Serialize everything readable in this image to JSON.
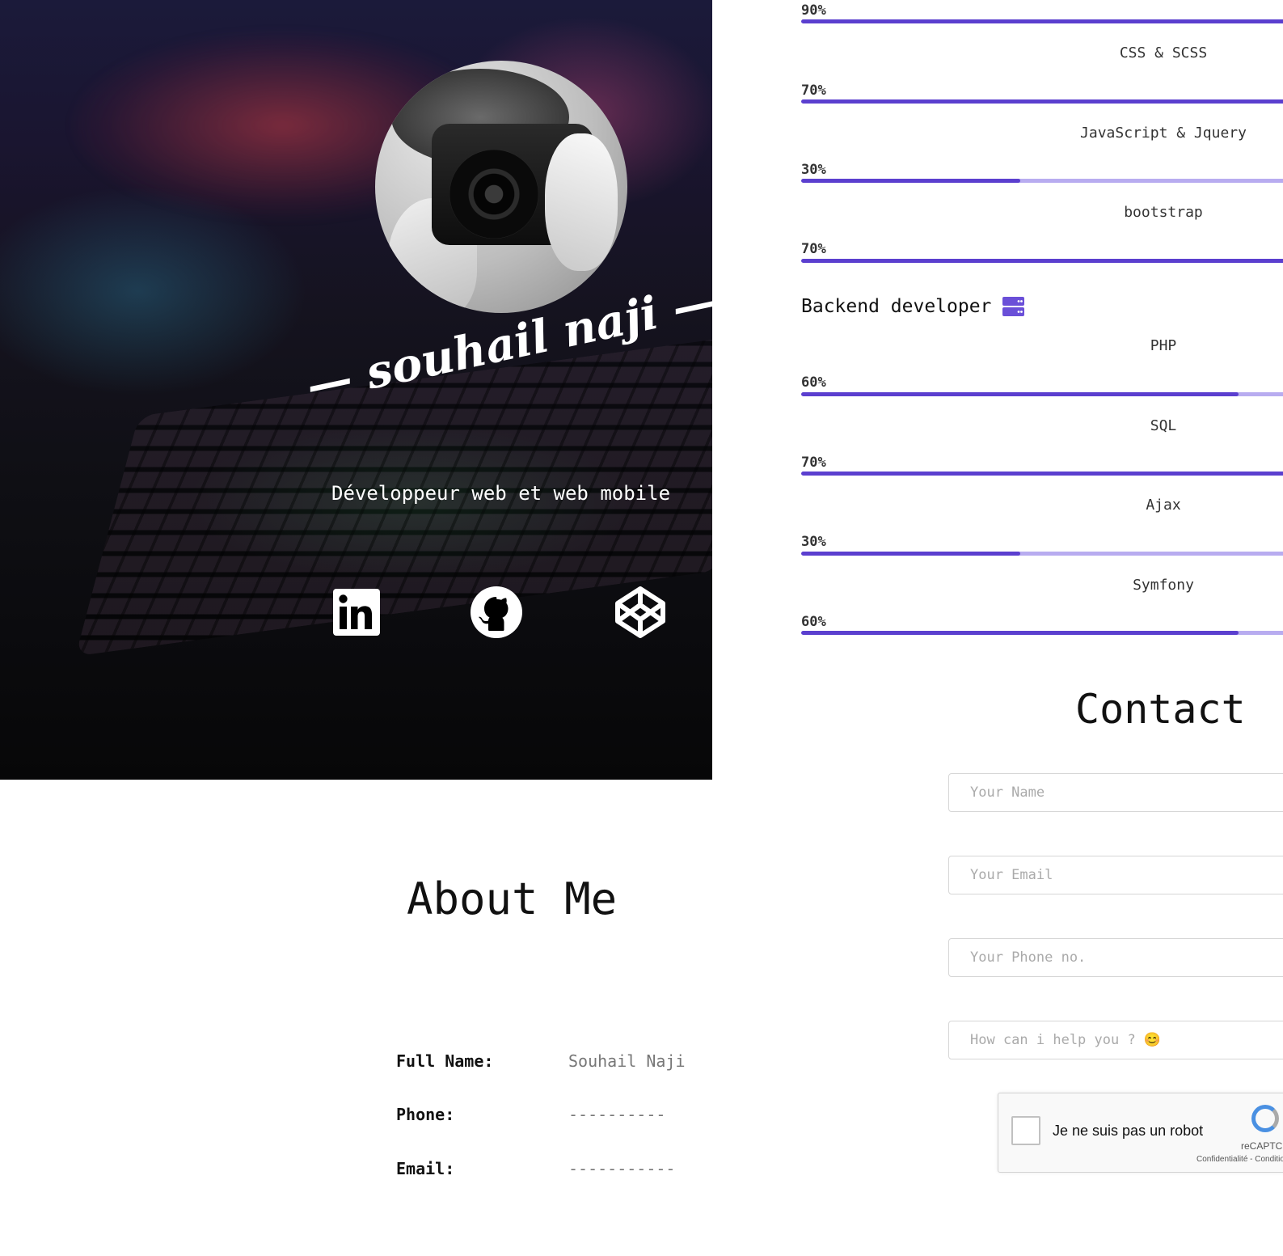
{
  "hero": {
    "name": "— souhail naji —",
    "subtitle": "Développeur web et web mobile",
    "social": [
      {
        "icon": "linkedin-icon"
      },
      {
        "icon": "github-icon"
      },
      {
        "icon": "codepen-icon"
      }
    ]
  },
  "skills": {
    "top": [
      {
        "name": "",
        "percent_label": "90%",
        "level": 1.0
      },
      {
        "name": "CSS & SCSS",
        "percent_label": "70%",
        "level": 1.0
      },
      {
        "name": "JavaScript & Jquery",
        "percent_label": "30%",
        "level": 0.41
      },
      {
        "name": "bootstrap",
        "percent_label": "70%",
        "level": 1.0
      }
    ],
    "backend_title": "Backend developer",
    "backend_icon": "server-icon",
    "backend": [
      {
        "name": "PHP",
        "percent_label": "60%",
        "level": 0.82
      },
      {
        "name": "SQL",
        "percent_label": "70%",
        "level": 1.0
      },
      {
        "name": "Ajax",
        "percent_label": "30%",
        "level": 0.41
      },
      {
        "name": "Symfony",
        "percent_label": "60%",
        "level": 0.82
      }
    ],
    "accent_color": "#5b3fcf",
    "track_color": "#b8acf0"
  },
  "about": {
    "title": "About Me",
    "rows": [
      {
        "key": "Full Name:",
        "value": "Souhail Naji"
      },
      {
        "key": "Phone:",
        "value": "----------"
      },
      {
        "key": "Email:",
        "value": "-----------"
      }
    ]
  },
  "contact": {
    "title": "Contact",
    "name_placeholder": "Your Name",
    "email_placeholder": "Your Email",
    "phone_placeholder": "Your Phone no.",
    "message_placeholder": "How can i help you ? 😊",
    "captcha_label": "Je ne suis pas un robot",
    "captcha_brand": "reCAPTCHA",
    "captcha_terms": "Confidentialité - Conditions"
  }
}
